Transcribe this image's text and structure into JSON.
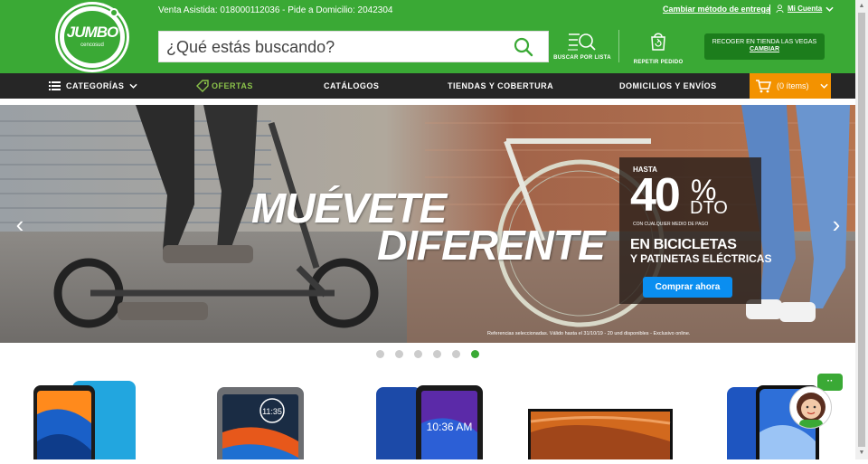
{
  "header": {
    "logo_word": "JUMBO",
    "logo_sub": "cencosud",
    "assist_text": "Venta Asistida: 018000112036 - Pide a Domicilio: 2042304",
    "change_delivery": "Cambiar método de entrega",
    "account": "Mi Cuenta",
    "search_placeholder": "¿Qué estás buscando?",
    "tool_list": "BUSCAR POR LISTA",
    "tool_repeat": "REPETIR PEDIDO",
    "pickup_line1": "RECOGER EN TIENDA LAS VEGAS",
    "pickup_line2": "CAMBIAR"
  },
  "nav": {
    "categories": "CATEGORÍAS",
    "offers": "OFERTAS",
    "catalogs": "CATÁLOGOS",
    "stores": "TIENDAS Y COBERTURA",
    "delivery": "DOMICILIOS Y ENVÍOS",
    "cart": "(0 ítems)"
  },
  "banner": {
    "title1": "MUÉVETE",
    "title2": "DIFERENTE",
    "upto": "HASTA",
    "percent": "40",
    "percent_sign": "%",
    "dto": "DTO",
    "condition": "CON CUALQUIER MEDIO DE PAGO",
    "line1": "EN BICICLETAS",
    "line2": "Y PATINETAS ELÉCTRICAS",
    "cta": "Comprar ahora",
    "fineprint": "Referencias seleccionadas. Válido hasta el 31/10/19 - 20 und disponibles - Exclusivo online.",
    "prev": "‹",
    "next": "›"
  },
  "carousel": {
    "slides": 6,
    "active_slide": 6
  },
  "products": [
    {
      "phone_time": ""
    },
    {
      "phone_time": "11:35"
    },
    {
      "phone_time": "10:36 AM"
    },
    {
      "phone_time": ""
    },
    {
      "phone_time": ""
    }
  ],
  "chat": {
    "bubble": "··"
  },
  "colors": {
    "brand_green": "#3aa935",
    "nav_dark": "#262626",
    "cart_orange": "#f39200",
    "cta_blue": "#0a8ef0"
  }
}
